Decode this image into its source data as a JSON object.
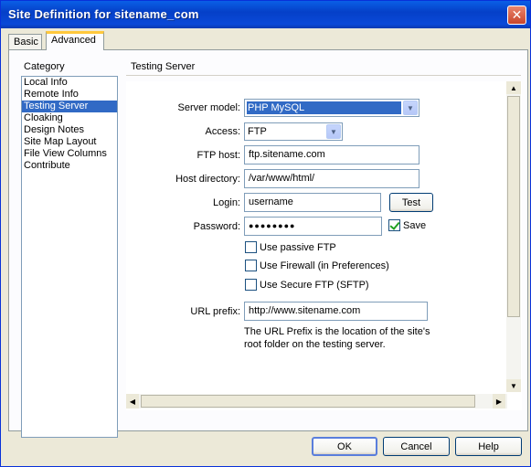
{
  "window": {
    "title": "Site Definition for sitename_com",
    "close_glyph": "✕"
  },
  "tabs": [
    {
      "label": "Basic"
    },
    {
      "label": "Advanced"
    }
  ],
  "category": {
    "label": "Category",
    "items": [
      {
        "label": "Local Info"
      },
      {
        "label": "Remote Info"
      },
      {
        "label": "Testing Server"
      },
      {
        "label": "Cloaking"
      },
      {
        "label": "Design Notes"
      },
      {
        "label": "Site Map Layout"
      },
      {
        "label": "File View Columns"
      },
      {
        "label": "Contribute"
      }
    ],
    "selected_index": 2
  },
  "panel": {
    "title": "Testing Server",
    "server_model": {
      "label": "Server model:",
      "value": "PHP MySQL"
    },
    "access": {
      "label": "Access:",
      "value": "FTP"
    },
    "ftp_host": {
      "label": "FTP host:",
      "value": "ftp.sitename.com"
    },
    "host_directory": {
      "label": "Host directory:",
      "value": "/var/www/html/"
    },
    "login": {
      "label": "Login:",
      "value": "username"
    },
    "test_button": "Test",
    "password": {
      "label": "Password:",
      "value": "●●●●●●●●"
    },
    "save": {
      "label": "Save",
      "checked": true
    },
    "use_passive_ftp": {
      "label": "Use passive FTP",
      "checked": false
    },
    "use_firewall": {
      "label": "Use Firewall (in Preferences)",
      "checked": false
    },
    "use_secure_ftp": {
      "label": "Use Secure FTP (SFTP)",
      "checked": false
    },
    "url_prefix": {
      "label": "URL prefix:",
      "value": "http://www.sitename.com"
    },
    "note": "The URL Prefix is the location of the site's root folder on the testing server."
  },
  "buttons": {
    "ok": "OK",
    "cancel": "Cancel",
    "help": "Help"
  },
  "colors": {
    "title_bar": "#0a49d8",
    "selection": "#316ac5",
    "tab_highlight": "#ffc83c",
    "check": "#21a121"
  },
  "icons": {
    "close": "close-icon",
    "dropdown": "chevron-down-icon",
    "scroll_up": "scroll-up-arrow-icon",
    "scroll_down": "scroll-down-arrow-icon",
    "scroll_left": "scroll-left-arrow-icon",
    "scroll_right": "scroll-right-arrow-icon"
  }
}
